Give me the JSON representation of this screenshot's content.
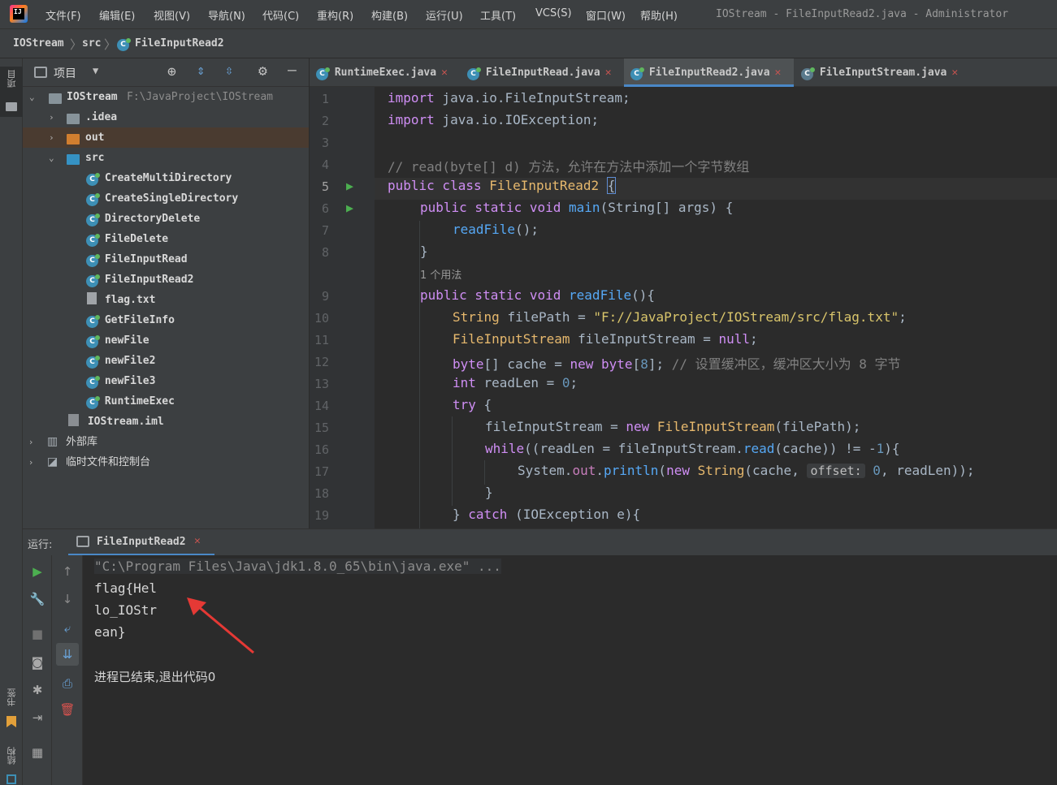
{
  "menu": [
    "文件(F)",
    "编辑(E)",
    "视图(V)",
    "导航(N)",
    "代码(C)",
    "重构(R)",
    "构建(B)",
    "运行(U)",
    "工具(T)",
    "VCS(S)",
    "窗口(W)",
    "帮助(H)"
  ],
  "window_title": "IOStream - FileInputRead2.java - Administrator",
  "breadcrumb": {
    "project": "IOStream",
    "folder": "src",
    "file": "FileInputRead2"
  },
  "left_strip": {
    "project_label": "项目",
    "bookmarks_label": "书签",
    "structure_label": "结构"
  },
  "project_panel": {
    "title": "项目",
    "root": {
      "name": "IOStream",
      "path": "F:\\JavaProject\\IOStream"
    },
    "items": [
      {
        "label": ".idea",
        "type": "folder"
      },
      {
        "label": "out",
        "type": "folder-orange"
      },
      {
        "label": "src",
        "type": "folder-blue"
      },
      {
        "label": "CreateMultiDirectory",
        "type": "class"
      },
      {
        "label": "CreateSingleDirectory",
        "type": "class"
      },
      {
        "label": "DirectoryDelete",
        "type": "class"
      },
      {
        "label": "FileDelete",
        "type": "class"
      },
      {
        "label": "FileInputRead",
        "type": "class"
      },
      {
        "label": "FileInputRead2",
        "type": "class"
      },
      {
        "label": "flag.txt",
        "type": "text"
      },
      {
        "label": "GetFileInfo",
        "type": "class"
      },
      {
        "label": "newFile",
        "type": "class"
      },
      {
        "label": "newFile2",
        "type": "class"
      },
      {
        "label": "newFile3",
        "type": "class"
      },
      {
        "label": "RuntimeExec",
        "type": "class"
      },
      {
        "label": "IOStream.iml",
        "type": "iml"
      },
      {
        "label": "外部库",
        "type": "library"
      },
      {
        "label": "临时文件和控制台",
        "type": "scratch"
      }
    ]
  },
  "editor_tabs": [
    {
      "label": "RuntimeExec.java",
      "active": false
    },
    {
      "label": "FileInputRead.java",
      "active": false
    },
    {
      "label": "FileInputRead2.java",
      "active": true
    },
    {
      "label": "FileInputStream.java",
      "active": false
    }
  ],
  "line_numbers": [
    "1",
    "2",
    "3",
    "4",
    "5",
    "6",
    "7",
    "8",
    "9",
    "10",
    "11",
    "12",
    "13",
    "14",
    "15",
    "16",
    "17",
    "18",
    "19"
  ],
  "usage_hint": "1 个用法",
  "code": {
    "import1_kw": "import",
    "import1": " java.io.FileInputStream;",
    "import2_kw": "import",
    "import2": " java.io.IOException;",
    "comment4": "// read(byte[] d) 方法，允许在方法中添加一个字节数组",
    "l5_kw": "public class ",
    "l5_cls": "FileInputRead2 ",
    "l5_brace": "{",
    "l6_kw": "public static void ",
    "l6_fn": "main",
    "l6_rest": "(String[] args) {",
    "l7_fn": "readFile",
    "l7_rest": "();",
    "l8": "}",
    "l9_kw": "public static void ",
    "l9_fn": "readFile",
    "l9_rest": "(){",
    "l10_type": "String ",
    "l10_var": "filePath = ",
    "l10_str": "\"F://JavaProject/IOStream/src/flag.txt\"",
    "l10_end": ";",
    "l11_type": "FileInputStream ",
    "l11_var": "fileInputStream = ",
    "l11_kw": "null",
    "l11_end": ";",
    "l12_type": "byte",
    "l12_a": "[] cache = ",
    "l12_kw": "new ",
    "l12_type2": "byte",
    "l12_b": "[",
    "l12_num": "8",
    "l12_c": "]; ",
    "l12_cm": "// 设置缓冲区，缓冲区大小为 8 字节",
    "l13_type": "int ",
    "l13_var": "readLen = ",
    "l13_num": "0",
    "l13_end": ";",
    "l14_kw": "try ",
    "l14_rest": "{",
    "l15_var": "fileInputStream = ",
    "l15_kw": "new ",
    "l15_cls": "FileInputStream",
    "l15_rest": "(filePath);",
    "l16_kw": "while",
    "l16_a": "((readLen = fileInputStream.",
    "l16_fn": "read",
    "l16_b": "(cache)) != -",
    "l16_num": "1",
    "l16_c": "){",
    "l17_a": "System.",
    "l17_fld": "out",
    "l17_b": ".",
    "l17_fn": "println",
    "l17_c": "(",
    "l17_kw": "new ",
    "l17_cls": "String",
    "l17_d": "(cache, ",
    "l17_hint": "offset:",
    "l17_num": " 0",
    "l17_e": ", readLen));",
    "l18": "}",
    "l19_a": "} ",
    "l19_kw": "catch ",
    "l19_b": "(IOException e){"
  },
  "run_panel": {
    "label": "运行:",
    "tab": "FileInputRead2"
  },
  "console": {
    "cmd": "\"C:\\Program Files\\Java\\jdk1.8.0_65\\bin\\java.exe\" ...",
    "out1": "flag{Hel",
    "out2": "lo_IOStr",
    "out3": "ean}",
    "exit": "进程已结束,退出代码0"
  },
  "colors": {
    "accent": "#4a88c7",
    "annotation_arrow": "#e53935"
  }
}
